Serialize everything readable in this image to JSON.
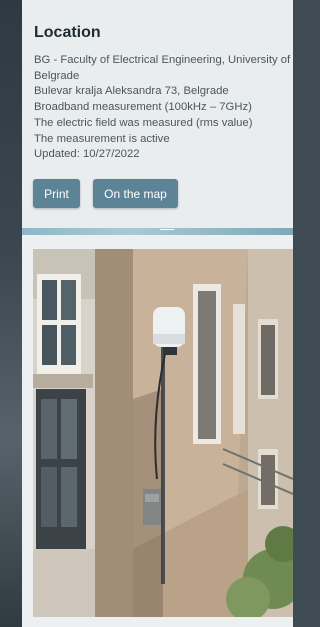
{
  "location": {
    "title": "Location",
    "lines": [
      "BG - Faculty of Electrical Engineering, University of Belgrade",
      "Bulevar kralja Aleksandra 73, Belgrade",
      "Broadband measurement (100kHz – 7GHz)",
      "The electric field was measured (rms value)",
      "The measurement is active",
      "Updated: 10/27/2022"
    ]
  },
  "actions": {
    "print_label": "Print",
    "map_label": "On the map"
  },
  "colors": {
    "button": "#5d8396",
    "panel": "#edf0f1",
    "divider": "#8fb7c7"
  }
}
